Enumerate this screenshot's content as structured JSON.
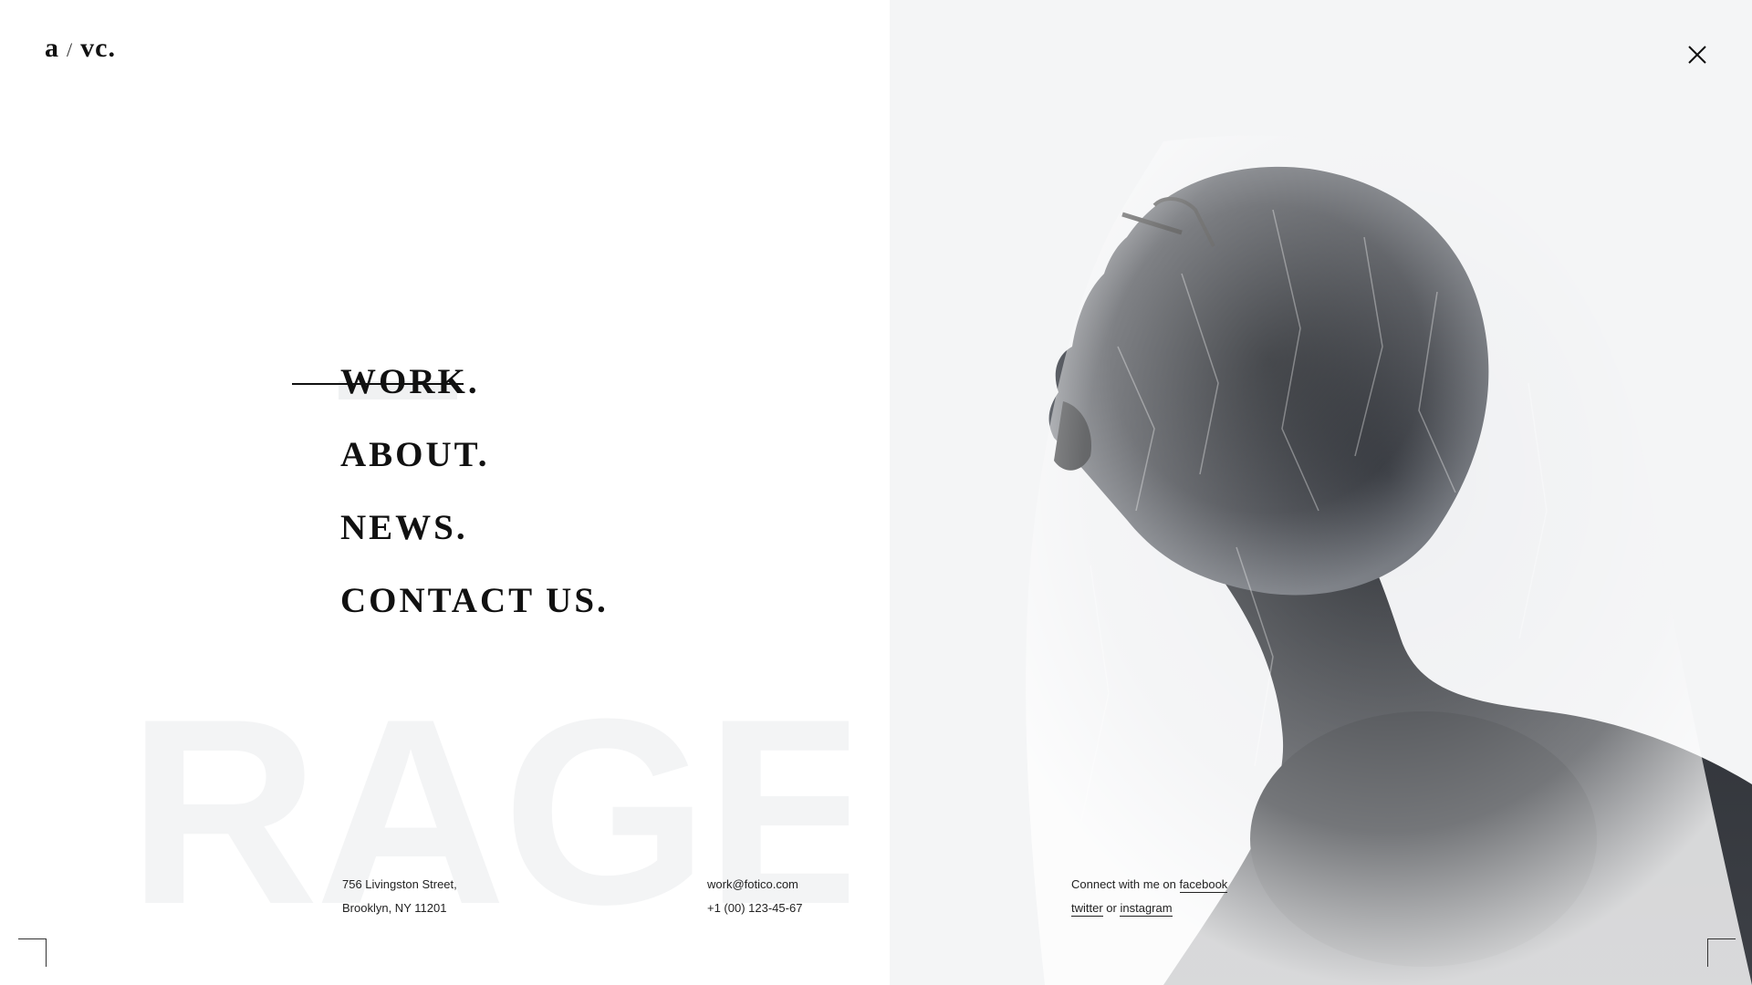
{
  "logo": {
    "part1": "a",
    "slash": "/",
    "part2": "vc."
  },
  "menu": [
    {
      "label": "WORK.",
      "active": true
    },
    {
      "label": "ABOUT.",
      "active": false
    },
    {
      "label": "NEWS.",
      "active": false
    },
    {
      "label": "CONTACT US.",
      "active": false
    }
  ],
  "watermark": "RAGE",
  "address": {
    "line1": "756 Livingston Street,",
    "line2": "Brooklyn, NY 11201"
  },
  "contact": {
    "email": "work@fotico.com",
    "phone": "+1 (00) 123-45-67"
  },
  "social": {
    "intro": "Connect with me on",
    "facebook": "facebook",
    "twitter": "twitter",
    "or": "or",
    "instagram": "instagram"
  },
  "icons": {
    "close": "close-icon"
  },
  "colors": {
    "background": "#ffffff",
    "photo_background": "#f4f5f6",
    "text": "#111111",
    "watermark": "#f3f4f5"
  }
}
